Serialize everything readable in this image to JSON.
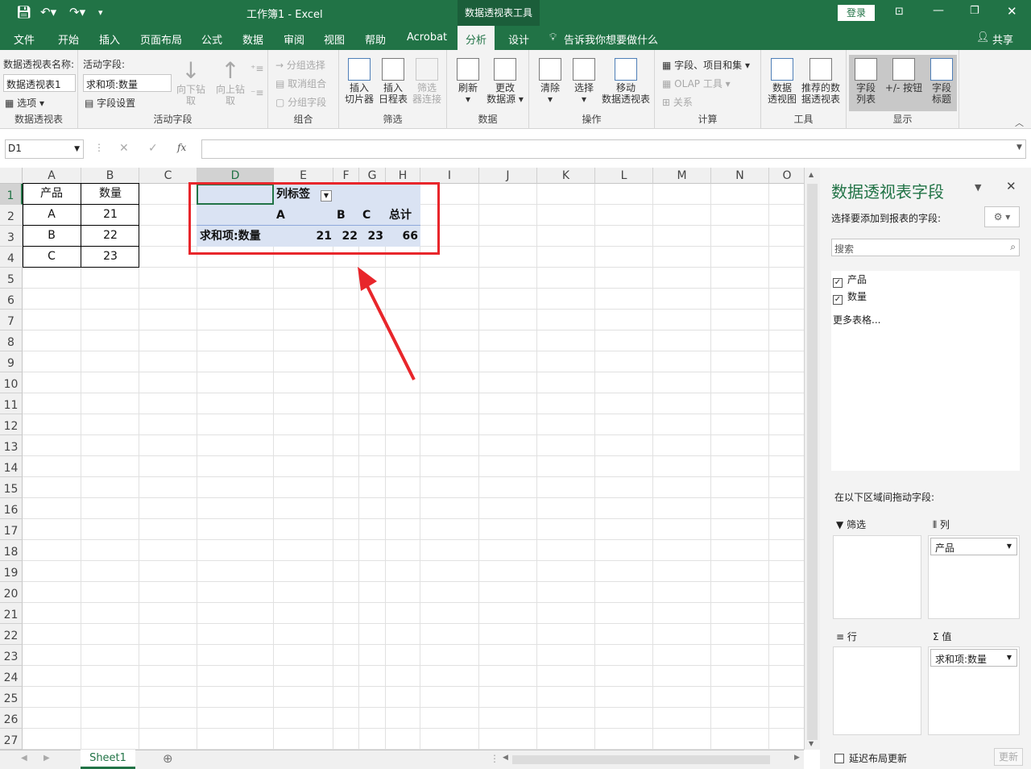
{
  "titlebar": {
    "title": "工作簿1  -  Excel",
    "context_tab": "数据透视表工具",
    "login": "登录"
  },
  "tabs": [
    "文件",
    "开始",
    "插入",
    "页面布局",
    "公式",
    "数据",
    "审阅",
    "视图",
    "帮助",
    "Acrobat",
    "分析",
    "设计"
  ],
  "active_tab": "分析",
  "tell_me": "告诉我你想要做什么",
  "share": "共享",
  "ribbon": {
    "pivot_name_label": "数据透视表名称:",
    "pivot_name_value": "数据透视表1",
    "options": "选项",
    "group_pivot": "数据透视表",
    "active_field_label": "活动字段:",
    "active_field_value": "求和项:数量",
    "field_settings": "字段设置",
    "drill_down": "向下钻取",
    "drill_up": "向上钻",
    "drill_up2": "取",
    "group_active_field": "活动字段",
    "group_selection": "分组选择",
    "ungroup": "取消组合",
    "group_field": "分组字段",
    "group_group": "组合",
    "insert_slicer": [
      "插入",
      "切片器"
    ],
    "insert_timeline": [
      "插入",
      "日程表"
    ],
    "filter_connections": [
      "筛选",
      "器连接"
    ],
    "group_filter": "筛选",
    "refresh": "刷新",
    "change_source": [
      "更改",
      "数据源"
    ],
    "group_data": "数据",
    "clear": "清除",
    "select": "选择",
    "move_pivot": [
      "移动",
      "数据透视表"
    ],
    "group_actions": "操作",
    "fields_items_sets": "字段、项目和集",
    "olap_tools": "OLAP 工具",
    "relationships": "关系",
    "group_calc": "计算",
    "pivot_chart": [
      "数据",
      "透视图"
    ],
    "recommended": [
      "推荐的数",
      "据透视表"
    ],
    "group_tools": "工具",
    "field_list": [
      "字段",
      "列表"
    ],
    "plus_minus": "+/- 按钮",
    "field_headers": [
      "字段",
      "标题"
    ],
    "group_show": "显示"
  },
  "formula_bar": {
    "name_box": "D1",
    "fx": "fx",
    "content": ""
  },
  "columns": [
    "A",
    "B",
    "C",
    "D",
    "E",
    "F",
    "G",
    "H",
    "I",
    "J",
    "K",
    "L",
    "M",
    "N",
    "O"
  ],
  "rows": [
    "1",
    "2",
    "3",
    "4",
    "5",
    "6",
    "7",
    "8",
    "9",
    "10",
    "11",
    "12",
    "13",
    "14",
    "15",
    "16",
    "17",
    "18",
    "19",
    "20",
    "21",
    "22",
    "23",
    "24",
    "25",
    "26",
    "27"
  ],
  "source_table": [
    [
      "产品",
      "数量"
    ],
    [
      "A",
      "21"
    ],
    [
      "B",
      "22"
    ],
    [
      "C",
      "23"
    ]
  ],
  "pivot": {
    "col_label": "列标签",
    "headers": [
      "A",
      "B",
      "C",
      "总计"
    ],
    "row_label": "求和项:数量",
    "values": [
      "21",
      "22",
      "23",
      "66"
    ]
  },
  "sheet_tab": "Sheet1",
  "pane": {
    "title": "数据透视表字段",
    "subtitle": "选择要添加到报表的字段:",
    "search_placeholder": "搜索",
    "fields": [
      "产品",
      "数量"
    ],
    "more_tables": "更多表格...",
    "drag_hint": "在以下区域间拖动字段:",
    "zone_filter": "筛选",
    "zone_columns": "列",
    "zone_rows": "行",
    "zone_values": "值",
    "columns_item": "产品",
    "values_item": "求和项:数量",
    "defer_update": "延迟布局更新",
    "update_button": "更新"
  },
  "colors": {
    "excel_green": "#217346",
    "pivot_blue": "#dae3f3",
    "annotation_red": "#e8262b"
  }
}
